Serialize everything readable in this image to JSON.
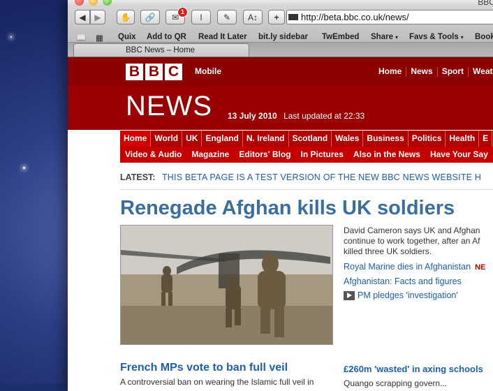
{
  "window": {
    "title": "BBC News – Ho",
    "tab_title": "BBC News – Home"
  },
  "toolbar": {
    "back_icon": "back-arrow-icon",
    "forward_icon": "forward-arrow-icon",
    "mail_badge": "1",
    "url": "http://beta.bbc.co.uk/news/"
  },
  "bookmarks": [
    {
      "label": "Quix",
      "dropdown": false
    },
    {
      "label": "Add to QR",
      "dropdown": false
    },
    {
      "label": "Read It Later",
      "dropdown": false
    },
    {
      "label": "bit.ly sidebar",
      "dropdown": false
    },
    {
      "label": "TwEmbed",
      "dropdown": false
    },
    {
      "label": "Share",
      "dropdown": true
    },
    {
      "label": "Favs & Tools",
      "dropdown": true
    },
    {
      "label": "Book",
      "dropdown": false
    }
  ],
  "site": {
    "logo_letters": [
      "B",
      "B",
      "C"
    ],
    "mobile_label": "Mobile",
    "top_nav": [
      "Home",
      "News",
      "Sport",
      "Weat"
    ],
    "news_title": "NEWS",
    "date": "13 July 2010",
    "last_updated": "Last updated at 22:33",
    "nav_primary": [
      "Home",
      "World",
      "UK",
      "England",
      "N. Ireland",
      "Scotland",
      "Wales",
      "Business",
      "Politics",
      "Health",
      "E"
    ],
    "nav_secondary": [
      "Video & Audio",
      "Magazine",
      "Editors' Blog",
      "In Pictures",
      "Also in the News",
      "Have Your Say"
    ],
    "latest_label": "LATEST:",
    "latest_text": "THIS BETA PAGE IS A TEST VERSION OF THE NEW BBC NEWS WEBSITE H"
  },
  "main_story": {
    "headline": "Renegade Afghan kills UK soldiers",
    "summary_lines": [
      "David Cameron says UK and Afghan",
      "continue to work together, after an Af",
      "killed three UK soldiers."
    ],
    "related": [
      {
        "label": "Royal Marine dies in Afghanistan",
        "tag": "NE"
      },
      {
        "label": "Afghanistan: Facts and figures",
        "tag": ""
      },
      {
        "label": "PM pledges 'investigation'",
        "tag": ""
      }
    ]
  },
  "secondary": {
    "headline": "French MPs vote to ban full veil",
    "text": "A controversial ban on wearing the Islamic full veil in",
    "side_headline": "£260m 'wasted' in axing schools",
    "side_text": "Quango scrapping govern..."
  }
}
